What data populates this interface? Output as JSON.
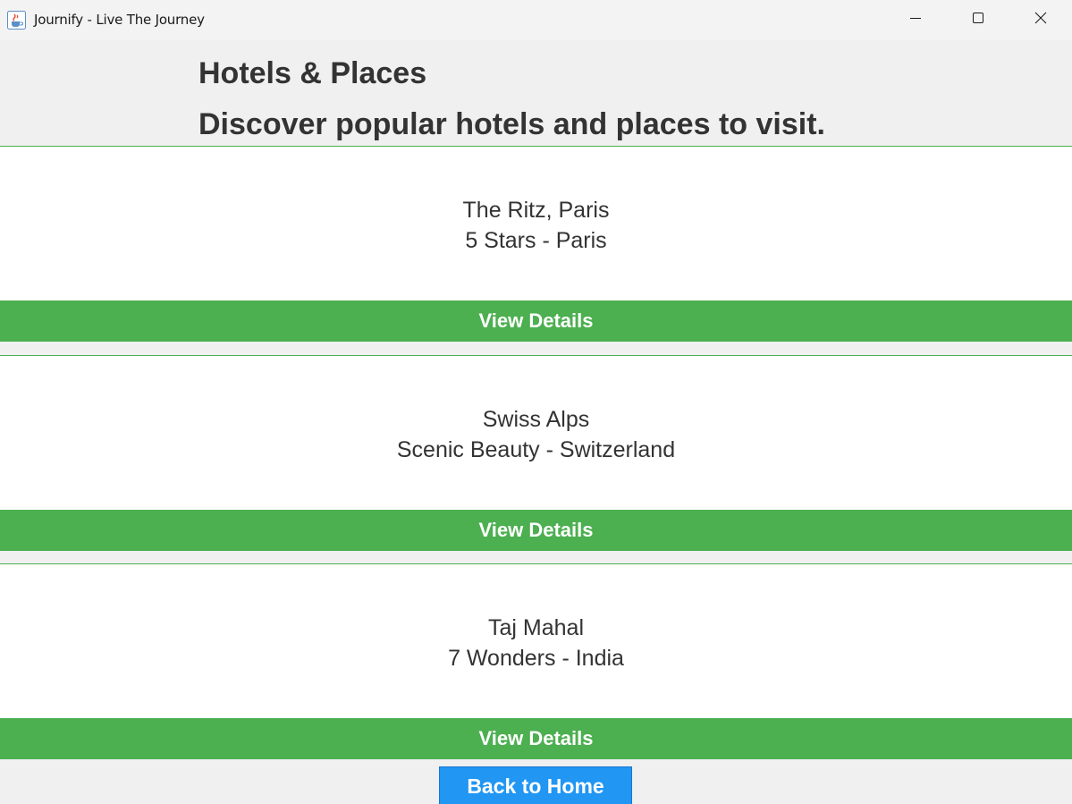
{
  "window": {
    "title": "Journify - Live The Journey"
  },
  "header": {
    "title": "Hotels & Places",
    "subtitle": "Discover popular hotels and places to visit."
  },
  "cards": [
    {
      "name": "The Ritz, Paris",
      "detail": "5 Stars - Paris",
      "button_label": "View Details"
    },
    {
      "name": "Swiss Alps",
      "detail": "Scenic Beauty - Switzerland",
      "button_label": "View Details"
    },
    {
      "name": "Taj Mahal",
      "detail": "7 Wonders - India",
      "button_label": "View Details"
    }
  ],
  "footer": {
    "back_label": "Back to Home"
  },
  "colors": {
    "accent_green": "#4caf50",
    "accent_blue": "#2196f3",
    "text_dark": "#333333"
  },
  "icons": {
    "app": "java-coffee-icon",
    "minimize": "minimize-icon",
    "maximize": "maximize-icon",
    "close": "close-icon"
  }
}
